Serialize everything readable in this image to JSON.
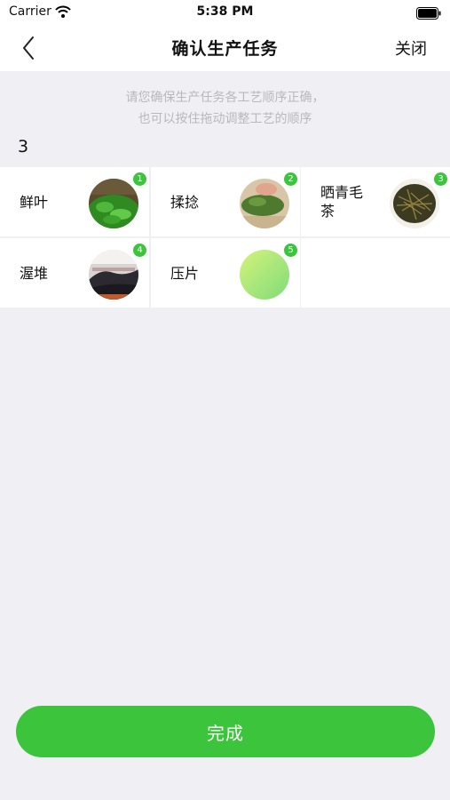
{
  "status_bar": {
    "carrier": "Carrier",
    "time": "5:38 PM"
  },
  "nav": {
    "title": "确认生产任务",
    "close_label": "关闭"
  },
  "hint": {
    "line1": "请您确保生产任务各工艺顺序正确，",
    "line2": "也可以按住拖动调整工艺的顺序"
  },
  "count": "3",
  "steps": [
    {
      "label": "鲜叶",
      "badge": "1",
      "image": "fresh-tea-leaves-photo"
    },
    {
      "label": "揉捻",
      "badge": "2",
      "image": "rolling-tea-photo"
    },
    {
      "label": "晒青毛茶",
      "badge": "3",
      "image": "sun-dried-tea-photo"
    },
    {
      "label": "渥堆",
      "badge": "4",
      "image": "pile-fermentation-photo"
    },
    {
      "label": "压片",
      "badge": "5",
      "image": "green-gradient-placeholder"
    }
  ],
  "done_label": "完成",
  "colors": {
    "accent": "#3cc43c",
    "background": "#efeff4",
    "hint_text": "#b9b9bd"
  }
}
